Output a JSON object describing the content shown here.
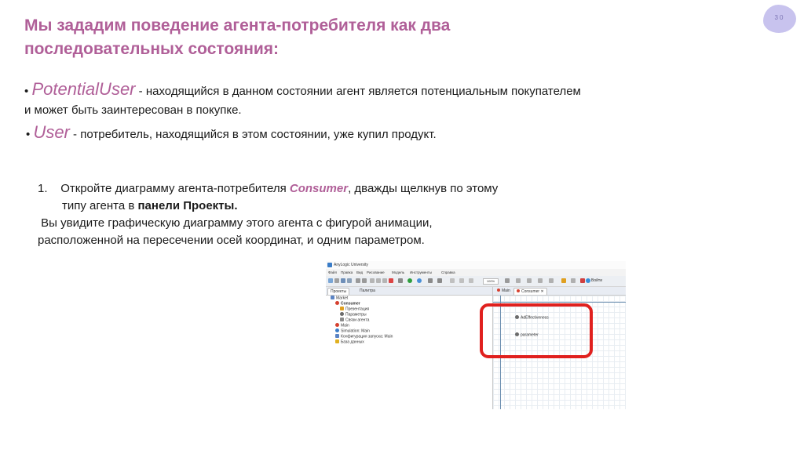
{
  "slide": {
    "page_number": "30",
    "title": "Мы зададим поведение агента-потребителя как два последовательных состояния:",
    "bullets": [
      {
        "marker": "•",
        "term": "PotentialUser",
        "text": " - находящийся в данном состоянии агент является потенциальным покупателем и может быть заинтересован в покупке."
      },
      {
        "marker": "•",
        "term": "User",
        "text": " - потребитель, находящийся в этом состоянии, уже купил продукт."
      }
    ],
    "step1": {
      "number": "1.",
      "text_a": "Откройте диаграмму агента-потребителя ",
      "highlight": "Consumer",
      "text_b": ", дважды щелкнув по этому",
      "line2_a": "типу агента в ",
      "line2_bold": "панели Проекты.",
      "line3": " Вы увидите графическую диаграмму этого агента с фигурой анимации,",
      "line4": "расположенной на пересечении осей координат, и одним параметром."
    }
  },
  "screenshot": {
    "window_title": "AnyLogic University",
    "menu": [
      "Файл",
      "Правка",
      "Вид",
      "Рисование",
      "Модель",
      "Инструменты",
      "Справка"
    ],
    "zoom": "100%",
    "login_label": "Войти",
    "panel_tabs": [
      "Проекты",
      "Палитра"
    ],
    "editor_tabs": [
      "Main",
      "Consumer"
    ],
    "tree": [
      "Market",
      "Consumer",
      "Презентация",
      "Параметры",
      "Связи агента",
      "Main",
      "Simulation: Main",
      "Конфигурация запуска: Main",
      "База данных"
    ],
    "canvas_elements": [
      "AdEffectiveness",
      "parameter"
    ],
    "colors": {
      "accent": "#b05f98",
      "highlight_box": "#e0201e",
      "badge": "#c8c3ee"
    }
  }
}
